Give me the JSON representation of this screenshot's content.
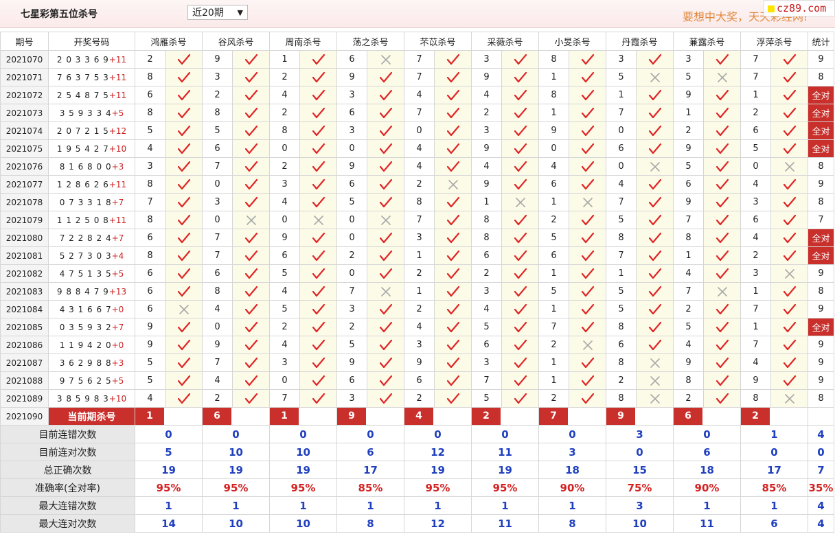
{
  "header": {
    "title": "七星彩第五位杀号",
    "period_select": "近20期",
    "marquee": "要想中大奖，天天彩经网!",
    "site_badge": "cz89.com"
  },
  "columns": {
    "issue": "期号",
    "draw": "开奖号码",
    "experts": [
      "鸿雁杀号",
      "谷风杀号",
      "周南杀号",
      "荡之杀号",
      "芣苡杀号",
      "采薇杀号",
      "小旻杀号",
      "丹霞杀号",
      "蒹露杀号",
      "浮萍杀号"
    ],
    "stat": "统计"
  },
  "rows": [
    {
      "issue": "2021070",
      "digits": "2 0 3 3 6 9",
      "sum": "+11",
      "nums": [
        "2",
        "9",
        "1",
        "6",
        "7",
        "3",
        "8",
        "3",
        "3",
        "7"
      ],
      "marks": [
        1,
        1,
        1,
        0,
        1,
        1,
        1,
        1,
        1,
        1
      ],
      "stat": "9"
    },
    {
      "issue": "2021071",
      "digits": "7 6 3 7 5 3",
      "sum": "+11",
      "nums": [
        "8",
        "3",
        "2",
        "9",
        "7",
        "9",
        "1",
        "5",
        "5",
        "7"
      ],
      "marks": [
        1,
        1,
        1,
        1,
        1,
        1,
        1,
        0,
        0,
        1
      ],
      "stat": "8"
    },
    {
      "issue": "2021072",
      "digits": "2 5 4 8 7 5",
      "sum": "+11",
      "nums": [
        "6",
        "2",
        "4",
        "3",
        "4",
        "4",
        "8",
        "1",
        "9",
        "1"
      ],
      "marks": [
        1,
        1,
        1,
        1,
        1,
        1,
        1,
        1,
        1,
        1
      ],
      "stat": "全对"
    },
    {
      "issue": "2021073",
      "digits": "3 5 9 3 3 4",
      "sum": "+5",
      "nums": [
        "8",
        "8",
        "2",
        "6",
        "7",
        "2",
        "1",
        "7",
        "1",
        "2"
      ],
      "marks": [
        1,
        1,
        1,
        1,
        1,
        1,
        1,
        1,
        1,
        1
      ],
      "stat": "全对"
    },
    {
      "issue": "2021074",
      "digits": "2 0 7 2 1 5",
      "sum": "+12",
      "nums": [
        "5",
        "5",
        "8",
        "3",
        "0",
        "3",
        "9",
        "0",
        "2",
        "6"
      ],
      "marks": [
        1,
        1,
        1,
        1,
        1,
        1,
        1,
        1,
        1,
        1
      ],
      "stat": "全对"
    },
    {
      "issue": "2021075",
      "digits": "1 9 5 4 2 7",
      "sum": "+10",
      "nums": [
        "4",
        "6",
        "0",
        "0",
        "4",
        "9",
        "0",
        "6",
        "9",
        "5"
      ],
      "marks": [
        1,
        1,
        1,
        1,
        1,
        1,
        1,
        1,
        1,
        1
      ],
      "stat": "全对"
    },
    {
      "issue": "2021076",
      "digits": "8 1 6 8 0 0",
      "sum": "+3",
      "nums": [
        "3",
        "7",
        "2",
        "9",
        "4",
        "4",
        "4",
        "0",
        "5",
        "0"
      ],
      "marks": [
        1,
        1,
        1,
        1,
        1,
        1,
        1,
        0,
        1,
        0
      ],
      "stat": "8"
    },
    {
      "issue": "2021077",
      "digits": "1 2 8 6 2 6",
      "sum": "+11",
      "nums": [
        "8",
        "0",
        "3",
        "6",
        "2",
        "9",
        "6",
        "4",
        "6",
        "4"
      ],
      "marks": [
        1,
        1,
        1,
        1,
        0,
        1,
        1,
        1,
        1,
        1
      ],
      "stat": "9"
    },
    {
      "issue": "2021078",
      "digits": "0 7 3 3 1 8",
      "sum": "+7",
      "nums": [
        "7",
        "3",
        "4",
        "5",
        "8",
        "1",
        "1",
        "7",
        "9",
        "3"
      ],
      "marks": [
        1,
        1,
        1,
        1,
        1,
        0,
        0,
        1,
        1,
        1
      ],
      "stat": "8"
    },
    {
      "issue": "2021079",
      "digits": "1 1 2 5 0 8",
      "sum": "+11",
      "nums": [
        "8",
        "0",
        "0",
        "0",
        "7",
        "8",
        "2",
        "5",
        "7",
        "6"
      ],
      "marks": [
        1,
        0,
        0,
        0,
        1,
        1,
        1,
        1,
        1,
        1
      ],
      "stat": "7"
    },
    {
      "issue": "2021080",
      "digits": "7 2 2 8 2 4",
      "sum": "+7",
      "nums": [
        "6",
        "7",
        "9",
        "0",
        "3",
        "8",
        "5",
        "8",
        "8",
        "4"
      ],
      "marks": [
        1,
        1,
        1,
        1,
        1,
        1,
        1,
        1,
        1,
        1
      ],
      "stat": "全对"
    },
    {
      "issue": "2021081",
      "digits": "5 2 7 3 0 3",
      "sum": "+4",
      "nums": [
        "8",
        "7",
        "6",
        "2",
        "1",
        "6",
        "6",
        "7",
        "1",
        "2"
      ],
      "marks": [
        1,
        1,
        1,
        1,
        1,
        1,
        1,
        1,
        1,
        1
      ],
      "stat": "全对"
    },
    {
      "issue": "2021082",
      "digits": "4 7 5 1 3 5",
      "sum": "+5",
      "nums": [
        "6",
        "6",
        "5",
        "0",
        "2",
        "2",
        "1",
        "1",
        "4",
        "3"
      ],
      "marks": [
        1,
        1,
        1,
        1,
        1,
        1,
        1,
        1,
        1,
        0
      ],
      "stat": "9"
    },
    {
      "issue": "2021083",
      "digits": "9 8 8 4 7 9",
      "sum": "+13",
      "nums": [
        "6",
        "8",
        "4",
        "7",
        "1",
        "3",
        "5",
        "5",
        "7",
        "1"
      ],
      "marks": [
        1,
        1,
        1,
        0,
        1,
        1,
        1,
        1,
        0,
        1
      ],
      "stat": "8"
    },
    {
      "issue": "2021084",
      "digits": "4 3 1 6 6 7",
      "sum": "+0",
      "nums": [
        "6",
        "4",
        "5",
        "3",
        "2",
        "4",
        "1",
        "5",
        "2",
        "7"
      ],
      "marks": [
        0,
        1,
        1,
        1,
        1,
        1,
        1,
        1,
        1,
        1
      ],
      "stat": "9"
    },
    {
      "issue": "2021085",
      "digits": "0 3 5 9 3 2",
      "sum": "+7",
      "nums": [
        "9",
        "0",
        "2",
        "2",
        "4",
        "5",
        "7",
        "8",
        "5",
        "1"
      ],
      "marks": [
        1,
        1,
        1,
        1,
        1,
        1,
        1,
        1,
        1,
        1
      ],
      "stat": "全对"
    },
    {
      "issue": "2021086",
      "digits": "1 1 9 4 2 0",
      "sum": "+0",
      "nums": [
        "9",
        "9",
        "4",
        "5",
        "3",
        "6",
        "2",
        "6",
        "4",
        "7"
      ],
      "marks": [
        1,
        1,
        1,
        1,
        1,
        1,
        0,
        1,
        1,
        1
      ],
      "stat": "9"
    },
    {
      "issue": "2021087",
      "digits": "3 6 2 9 8 8",
      "sum": "+3",
      "nums": [
        "5",
        "7",
        "3",
        "9",
        "9",
        "3",
        "1",
        "8",
        "9",
        "4"
      ],
      "marks": [
        1,
        1,
        1,
        1,
        1,
        1,
        1,
        0,
        1,
        1
      ],
      "stat": "9"
    },
    {
      "issue": "2021088",
      "digits": "9 7 5 6 2 5",
      "sum": "+5",
      "nums": [
        "5",
        "4",
        "0",
        "6",
        "6",
        "7",
        "1",
        "2",
        "8",
        "9"
      ],
      "marks": [
        1,
        1,
        1,
        1,
        1,
        1,
        1,
        0,
        1,
        1
      ],
      "stat": "9"
    },
    {
      "issue": "2021089",
      "digits": "3 8 5 9 8 3",
      "sum": "+10",
      "nums": [
        "4",
        "2",
        "7",
        "3",
        "2",
        "5",
        "2",
        "8",
        "2",
        "8"
      ],
      "marks": [
        1,
        1,
        1,
        1,
        1,
        1,
        1,
        0,
        1,
        0
      ],
      "stat": "8"
    }
  ],
  "current": {
    "issue": "2021090",
    "label": "当前期杀号",
    "kills": [
      "1",
      "6",
      "1",
      "9",
      "4",
      "2",
      "7",
      "9",
      "6",
      "2"
    ]
  },
  "stats": [
    {
      "label": "目前连错次数",
      "values": [
        "0",
        "0",
        "0",
        "0",
        "0",
        "0",
        "0",
        "3",
        "0",
        "1"
      ],
      "total": "4",
      "color": "blue"
    },
    {
      "label": "目前连对次数",
      "values": [
        "5",
        "10",
        "10",
        "6",
        "12",
        "11",
        "3",
        "0",
        "6",
        "0"
      ],
      "total": "0",
      "color": "blue"
    },
    {
      "label": "总正确次数",
      "values": [
        "19",
        "19",
        "19",
        "17",
        "19",
        "19",
        "18",
        "15",
        "18",
        "17"
      ],
      "total": "7",
      "color": "blue"
    },
    {
      "label": "准确率(全对率)",
      "values": [
        "95%",
        "95%",
        "95%",
        "85%",
        "95%",
        "95%",
        "90%",
        "75%",
        "90%",
        "85%"
      ],
      "total": "35%",
      "color": "red"
    },
    {
      "label": "最大连错次数",
      "values": [
        "1",
        "1",
        "1",
        "1",
        "1",
        "1",
        "1",
        "3",
        "1",
        "1"
      ],
      "total": "4",
      "color": "blue"
    },
    {
      "label": "最大连对次数",
      "values": [
        "14",
        "10",
        "10",
        "8",
        "12",
        "11",
        "8",
        "10",
        "11",
        "6"
      ],
      "total": "4",
      "color": "blue"
    }
  ],
  "colors": {
    "accent": "#c9302c",
    "check": "#e02424",
    "cross": "#a8a8a8",
    "blue": "#1f3fbf",
    "red": "#d42222"
  },
  "icons": {
    "correct": "check-icon",
    "wrong": "cross-icon"
  }
}
